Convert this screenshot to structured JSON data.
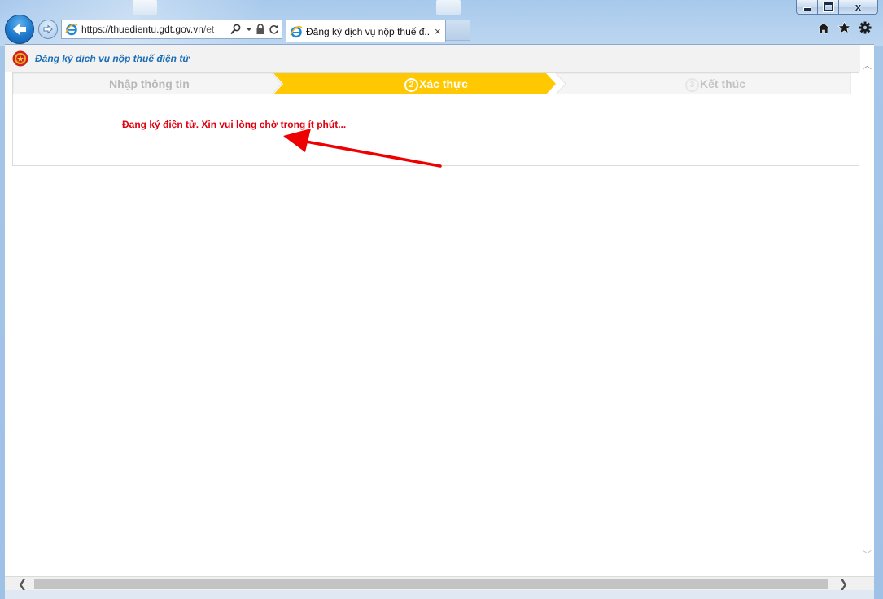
{
  "browser": {
    "url_host": "https://thuedientu.gdt.gov.vn",
    "url_path": "/et",
    "tab_title": "Đăng ký dịch vụ nộp thuế đ...",
    "tab_close": "×",
    "window_close": "x"
  },
  "page": {
    "title": "Đăng ký dịch vụ nộp thuế điện tử",
    "steps": [
      {
        "label": "Nhập thông tin",
        "state": "done"
      },
      {
        "number": "2",
        "label": "Xác thực",
        "state": "active"
      },
      {
        "number": "3",
        "label": "Kết thúc",
        "state": "pending"
      }
    ],
    "message": "Đang ký điện tử. Xin vui lòng chờ trong ít phút..."
  },
  "colors": {
    "active_step": "#ffc800",
    "inactive_step": "#f5f5f5",
    "message": "#e0000f",
    "annotation_arrow": "#ee0000",
    "title": "#1a6db6"
  },
  "icons": [
    "back-arrow-icon",
    "forward-arrow-icon",
    "ie-logo-icon",
    "search-icon",
    "lock-icon",
    "refresh-icon",
    "home-icon",
    "star-icon",
    "gear-icon",
    "emblem-icon"
  ]
}
